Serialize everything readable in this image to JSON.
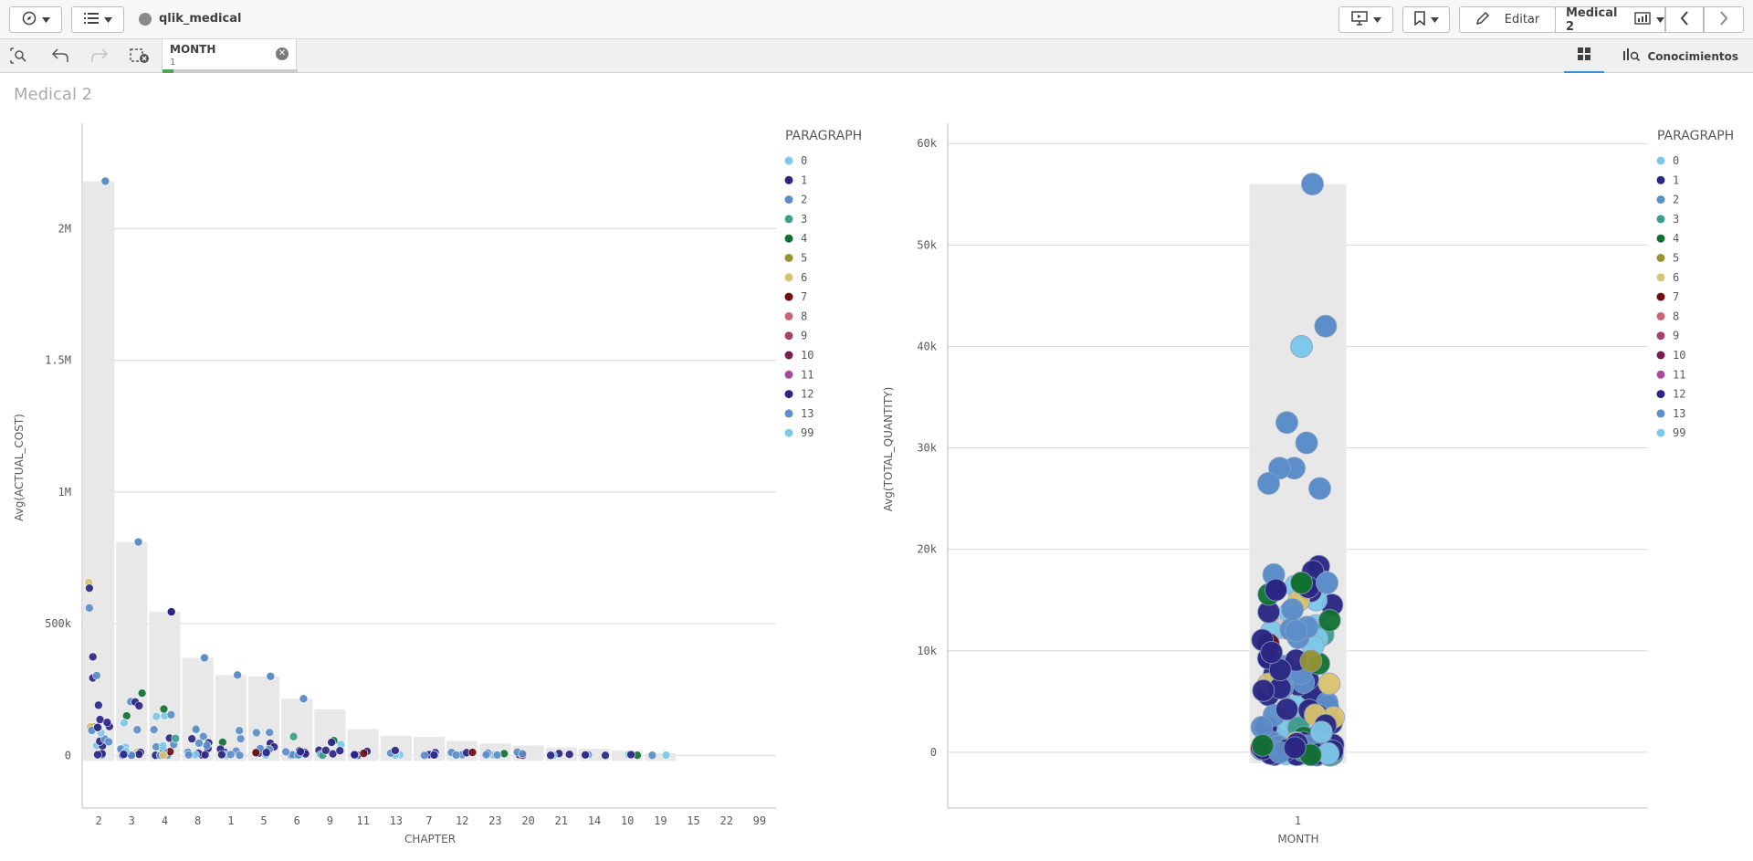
{
  "app": {
    "name": "qlik_medical"
  },
  "toolbar": {
    "edit_label": "Editar",
    "sheet_label": "Medical 2"
  },
  "selections": {
    "field": "MONTH",
    "value": "1",
    "insights_label": "Conocimientos"
  },
  "sheet": {
    "title": "Medical 2"
  },
  "chart_data": [
    {
      "type": "bar",
      "subtype": "bar with distribution points",
      "ylabel": "Avg(ACTUAL_COST)",
      "xlabel": "CHAPTER",
      "ylim": [
        -200000,
        2400000
      ],
      "yticks": [
        "0",
        "500k",
        "1M",
        "1.5M",
        "2M"
      ],
      "categories": [
        "2",
        "3",
        "4",
        "8",
        "1",
        "5",
        "6",
        "9",
        "11",
        "13",
        "7",
        "12",
        "23",
        "20",
        "21",
        "14",
        "10",
        "19",
        "15",
        "22",
        "99"
      ],
      "values": [
        2180000,
        810000,
        545000,
        370000,
        305000,
        300000,
        215000,
        175000,
        100000,
        75000,
        70000,
        55000,
        45000,
        38000,
        30000,
        25000,
        18000,
        8000,
        0,
        0,
        0
      ],
      "legend": {
        "title": "PARAGRAPH",
        "items": [
          {
            "label": "0",
            "color": "#7ec8e9"
          },
          {
            "label": "1",
            "color": "#2a2683"
          },
          {
            "label": "2",
            "color": "#5c8ec9"
          },
          {
            "label": "3",
            "color": "#3e9e8c"
          },
          {
            "label": "4",
            "color": "#127132"
          },
          {
            "label": "5",
            "color": "#969335"
          },
          {
            "label": "6",
            "color": "#d9c46e"
          },
          {
            "label": "7",
            "color": "#6e0e10"
          },
          {
            "label": "8",
            "color": "#c66676"
          },
          {
            "label": "9",
            "color": "#a6426a"
          },
          {
            "label": "10",
            "color": "#7a1b53"
          },
          {
            "label": "11",
            "color": "#a74b9a"
          },
          {
            "label": "12",
            "color": "#2a2683"
          },
          {
            "label": "13",
            "color": "#5c8ec9"
          },
          {
            "label": "99",
            "color": "#7ec8e9"
          }
        ]
      }
    },
    {
      "type": "bar",
      "subtype": "bar with distribution points",
      "ylabel": "Avg(TOTAL_QUANTITY)",
      "xlabel": "MONTH",
      "ylim": [
        -5500,
        62000
      ],
      "yticks": [
        "0",
        "10k",
        "20k",
        "30k",
        "40k",
        "50k",
        "60k"
      ],
      "categories": [
        "1"
      ],
      "values": [
        56000
      ],
      "legend": {
        "title": "PARAGRAPH"
      }
    }
  ]
}
